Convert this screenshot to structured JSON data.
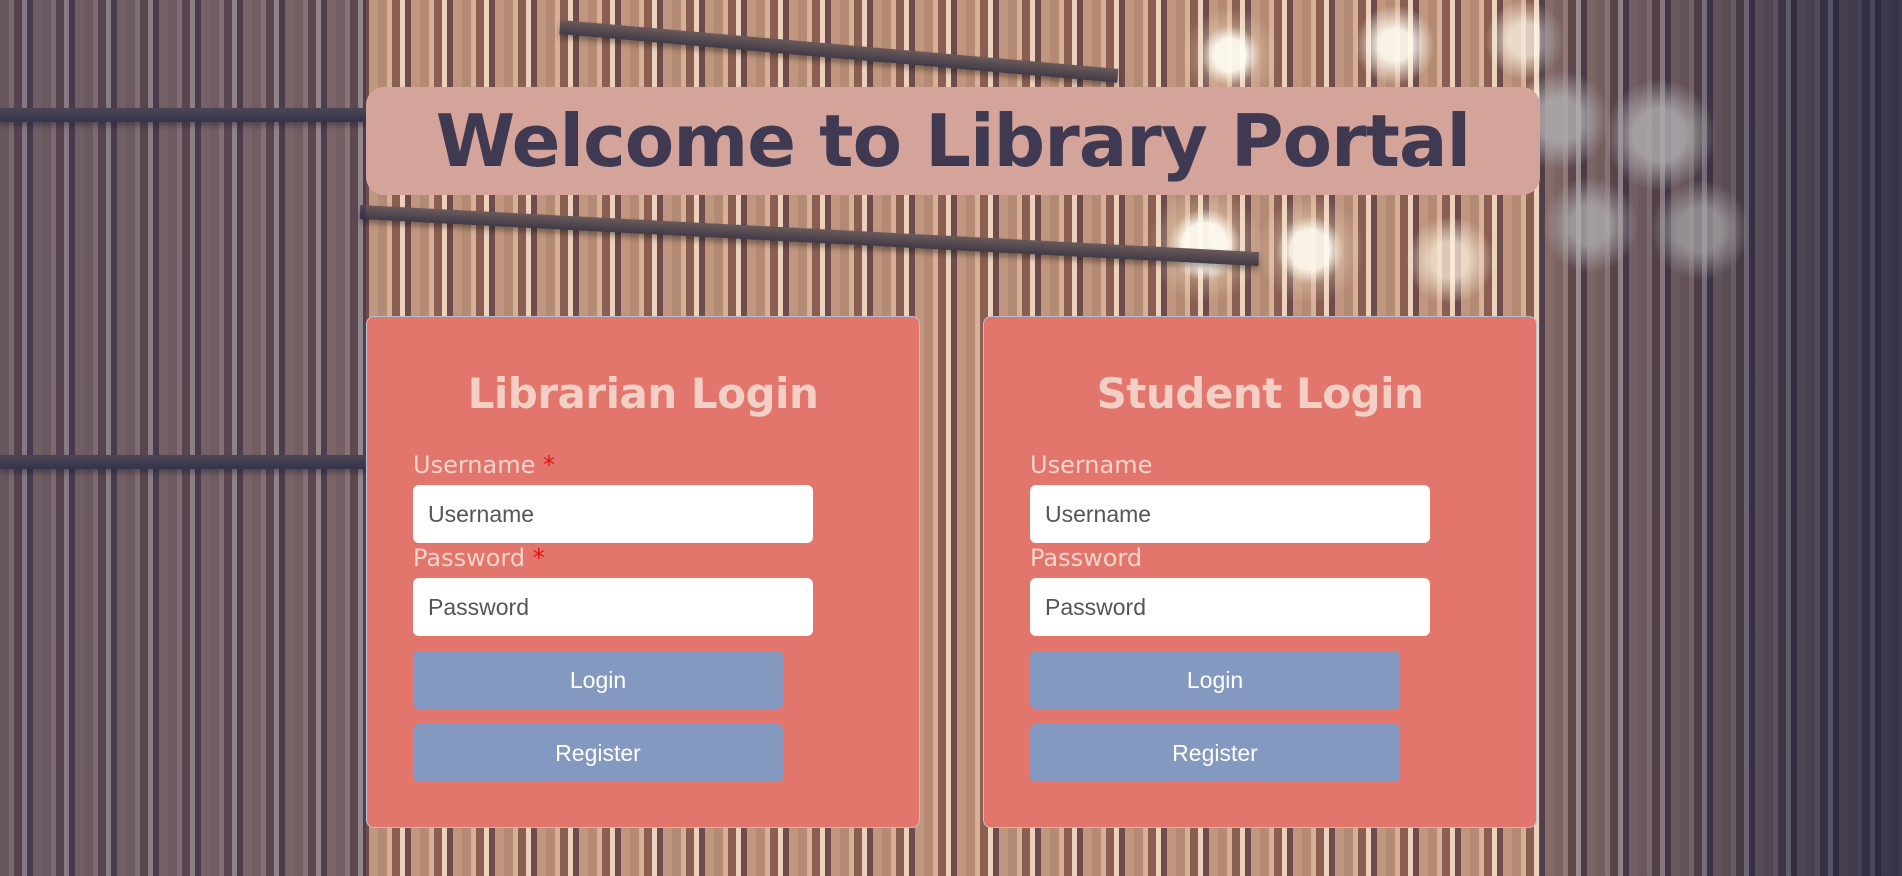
{
  "header": {
    "title": "Welcome to Library Portal"
  },
  "librarian": {
    "title": "Librarian Login",
    "username_label": "Username",
    "username_required": "*",
    "username_placeholder": "Username",
    "password_label": "Password",
    "password_required": "*",
    "password_placeholder": "Password",
    "login_label": "Login",
    "register_label": "Register"
  },
  "student": {
    "title": "Student Login",
    "username_label": "Username",
    "username_placeholder": "Username",
    "password_label": "Password",
    "password_placeholder": "Password",
    "login_label": "Login",
    "register_label": "Register"
  },
  "colors": {
    "banner": "#d4a39a",
    "title_text": "#3f3a52",
    "card": "#e2756c",
    "button": "#8499bf",
    "required": "#e11515"
  }
}
